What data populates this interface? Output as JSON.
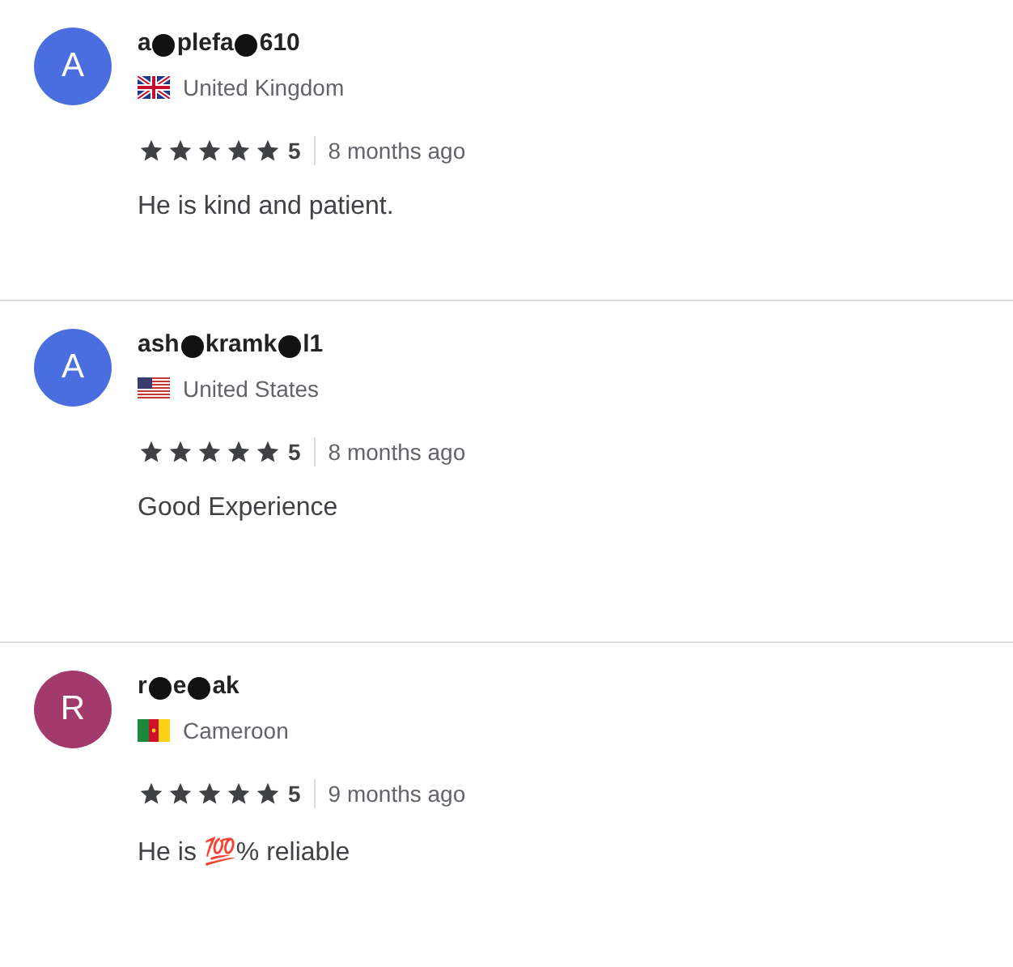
{
  "reviews": [
    {
      "initial": "A",
      "color": "#4a6ee0",
      "name_parts": [
        "a",
        "plefa",
        "610"
      ],
      "kind": "uk",
      "country": "United Kingdom",
      "stars": 5,
      "rating": "5",
      "time": "8 months ago",
      "text": "He is kind and patient."
    },
    {
      "initial": "A",
      "color": "#4a6ee0",
      "name_parts": [
        "ash",
        "kramk",
        "l1"
      ],
      "kind": "us",
      "country": "United States",
      "stars": 5,
      "rating": "5",
      "time": "8 months ago",
      "text": "Good Experience"
    },
    {
      "initial": "R",
      "color": "#a23b6b",
      "name_parts": [
        "r",
        "e",
        "ak"
      ],
      "kind": "cm",
      "country": "Cameroon",
      "stars": 5,
      "rating": "5",
      "time": "9 months ago",
      "text": "He is 💯% reliable"
    }
  ]
}
